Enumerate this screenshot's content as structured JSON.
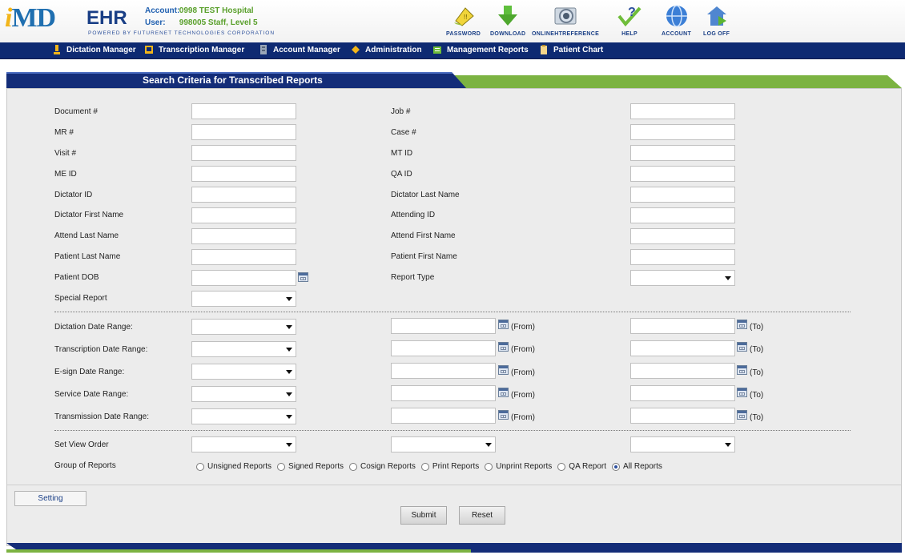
{
  "header": {
    "logo_brand": "iMD",
    "logo_product": "EHR",
    "logo_tagline": "POWERED BY FUTURENET TECHNOLOGIES CORPORATION",
    "account_label": "Account:",
    "account_value": "0998 TEST Hospital",
    "user_label": "User:",
    "user_value": "998005 Staff, Level 5"
  },
  "toolbar": [
    {
      "label": "PASSWORD",
      "icon": "password-icon"
    },
    {
      "label": "DOWNLOAD",
      "icon": "download-icon"
    },
    {
      "label": "ONLINEHTREFERENCE",
      "icon": "online-reference-icon"
    },
    {
      "label": "HELP",
      "icon": "help-icon"
    },
    {
      "label": "ACCOUNT",
      "icon": "account-icon"
    },
    {
      "label": "LOG OFF",
      "icon": "log-off-icon"
    }
  ],
  "nav": [
    {
      "label": "Dictation Manager",
      "icon": "dictation-icon"
    },
    {
      "label": "Transcription Manager",
      "icon": "transcription-icon"
    },
    {
      "label": "Account Manager",
      "icon": "account-manager-icon"
    },
    {
      "label": "Administration",
      "icon": "administration-icon"
    },
    {
      "label": "Management Reports",
      "icon": "reports-icon"
    },
    {
      "label": "Patient Chart",
      "icon": "patient-chart-icon"
    }
  ],
  "panel": {
    "title": "Search Criteria for Transcribed Reports"
  },
  "fields": {
    "document": {
      "label": "Document #",
      "value": ""
    },
    "job": {
      "label": "Job #",
      "value": ""
    },
    "mr": {
      "label": "MR #",
      "value": ""
    },
    "case": {
      "label": "Case #",
      "value": ""
    },
    "visit": {
      "label": "Visit #",
      "value": ""
    },
    "mt_id": {
      "label": "MT ID",
      "value": ""
    },
    "me_id": {
      "label": "ME ID",
      "value": ""
    },
    "qa_id": {
      "label": "QA ID",
      "value": ""
    },
    "dictator_id": {
      "label": "Dictator ID",
      "value": ""
    },
    "dictator_last": {
      "label": "Dictator Last Name",
      "value": ""
    },
    "dictator_first": {
      "label": "Dictator First Name",
      "value": ""
    },
    "attending_id": {
      "label": "Attending ID",
      "value": ""
    },
    "attend_last": {
      "label": "Attend Last Name",
      "value": ""
    },
    "attend_first": {
      "label": "Attend First Name",
      "value": ""
    },
    "patient_last": {
      "label": "Patient Last Name",
      "value": ""
    },
    "patient_first": {
      "label": "Patient First Name",
      "value": ""
    },
    "patient_dob": {
      "label": "Patient DOB",
      "value": ""
    },
    "report_type": {
      "label": "Report Type",
      "value": ""
    },
    "special_report": {
      "label": "Special Report",
      "value": ""
    }
  },
  "date_ranges": {
    "from_suffix": "(From)",
    "to_suffix": "(To)",
    "dictation": {
      "label": "Dictation Date Range:",
      "preset": "",
      "from": "",
      "to": ""
    },
    "transcription": {
      "label": "Transcription Date Range:",
      "preset": "",
      "from": "",
      "to": ""
    },
    "esign": {
      "label": "E-sign Date Range:",
      "preset": "",
      "from": "",
      "to": ""
    },
    "service": {
      "label": "Service Date Range:",
      "preset": "",
      "from": "",
      "to": ""
    },
    "transmission": {
      "label": "Transmission Date Range:",
      "preset": "",
      "from": "",
      "to": ""
    }
  },
  "view_order": {
    "label": "Set View Order",
    "first": "",
    "second": "",
    "third": ""
  },
  "group_of_reports": {
    "label": "Group of Reports",
    "options": [
      {
        "label": "Unsigned Reports",
        "selected": false
      },
      {
        "label": "Signed Reports",
        "selected": false
      },
      {
        "label": "Cosign Reports",
        "selected": false
      },
      {
        "label": "Print Reports",
        "selected": false
      },
      {
        "label": "Unprint Reports",
        "selected": false
      },
      {
        "label": "QA Report",
        "selected": false
      },
      {
        "label": "All Reports",
        "selected": true
      }
    ]
  },
  "buttons": {
    "setting": "Setting",
    "submit": "Submit",
    "reset": "Reset"
  },
  "colors": {
    "nav_bg": "#0e2a72",
    "accent_green": "#7cb342",
    "panel_bg": "#ececec"
  }
}
